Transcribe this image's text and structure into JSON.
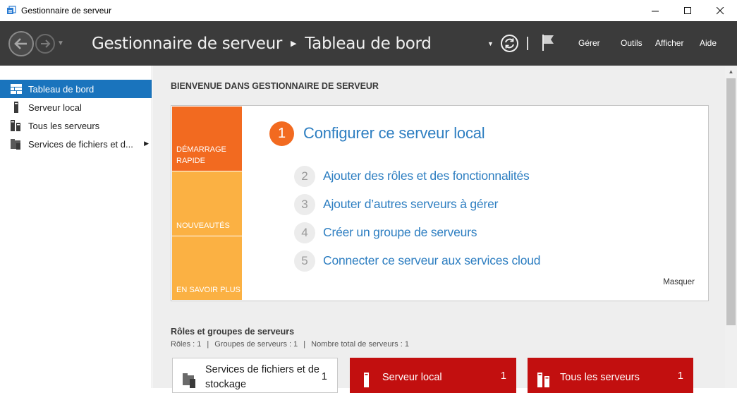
{
  "window": {
    "title": "Gestionnaire de serveur",
    "minimize": "—",
    "maximize": "☐",
    "close": "✕"
  },
  "header": {
    "breadcrumb_root": "Gestionnaire de serveur",
    "breadcrumb_sep": "▶",
    "breadcrumb_page": "Tableau de bord",
    "menus": [
      "Gérer",
      "Outils",
      "Afficher",
      "Aide"
    ]
  },
  "sidebar": {
    "items": [
      {
        "label": "Tableau de bord",
        "icon": "dashboard-icon",
        "active": true
      },
      {
        "label": "Serveur local",
        "icon": "server-icon"
      },
      {
        "label": "Tous les serveurs",
        "icon": "servers-icon"
      },
      {
        "label": "Services de fichiers et d...",
        "icon": "file-services-icon",
        "expand": "▶"
      }
    ]
  },
  "main": {
    "welcome": "BIENVENUE DANS GESTIONNAIRE DE SERVEUR",
    "quickstart": {
      "tabs": [
        "DÉMARRAGE RAPIDE",
        "NOUVEAUTÉS",
        "EN SAVOIR PLUS"
      ],
      "step1": {
        "num": "1",
        "label": "Configurer ce serveur local"
      },
      "steps": [
        {
          "num": "2",
          "label": "Ajouter des rôles et des fonctionnalités"
        },
        {
          "num": "3",
          "label": "Ajouter d’autres serveurs à gérer"
        },
        {
          "num": "4",
          "label": "Créer un groupe de serveurs"
        },
        {
          "num": "5",
          "label": "Connecter ce serveur aux services cloud"
        }
      ],
      "hide": "Masquer"
    },
    "roles": {
      "title": "Rôles et groupes de serveurs",
      "roles_count": "Rôles : 1",
      "groups_count": "Groupes de serveurs : 1",
      "servers_count": "Nombre total de serveurs : 1",
      "bar": "|"
    },
    "tiles": [
      {
        "name": "Services de fichiers et de stockage",
        "count": "1",
        "color": "#ffffff"
      },
      {
        "name": "Serveur local",
        "count": "1",
        "color": "#c20f0f"
      },
      {
        "name": "Tous les serveurs",
        "count": "1",
        "color": "#c20f0f"
      }
    ]
  },
  "colors": {
    "accent": "#1a74bd",
    "orange": "#f26a20",
    "amber": "#fbb143",
    "link": "#2d7ec1",
    "tile_red": "#c20f0f"
  }
}
